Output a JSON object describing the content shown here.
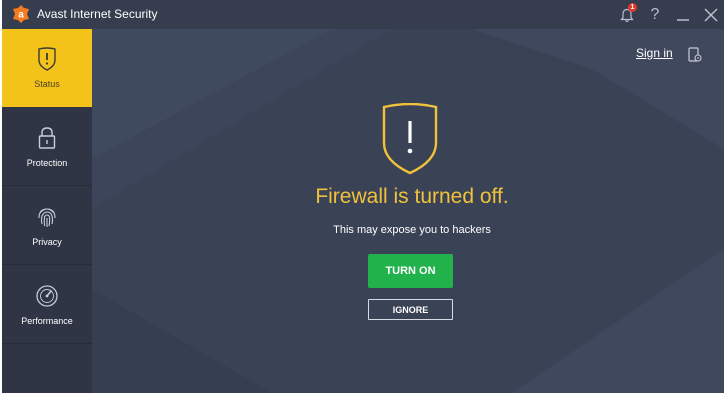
{
  "app": {
    "title": "Avast Internet Security",
    "logo_icon": "avast-logo-icon",
    "accent_color": "#f3c31a",
    "brand_orange": "#f57b20"
  },
  "titlebar": {
    "notifications": {
      "icon": "bell-icon",
      "badge_count": "1"
    },
    "help": {
      "label": "?",
      "icon": "help-icon"
    },
    "minimize_icon": "minimize-icon",
    "close_icon": "close-icon"
  },
  "sidebar": {
    "items": [
      {
        "label": "Status",
        "icon": "status-shield-icon",
        "active": true
      },
      {
        "label": "Protection",
        "icon": "lock-icon",
        "active": false
      },
      {
        "label": "Privacy",
        "icon": "fingerprint-icon",
        "active": false
      },
      {
        "label": "Performance",
        "icon": "speedometer-icon",
        "active": false
      }
    ]
  },
  "header": {
    "sign_in_label": "Sign in",
    "device_icon": "device-settings-icon"
  },
  "alert": {
    "icon": "warning-shield-icon",
    "headline": "Firewall is turned off.",
    "subtext": "This may expose you to hackers",
    "primary_button": "TURN ON",
    "secondary_button": "IGNORE",
    "headline_color": "#f0c23b",
    "primary_color": "#22b24c"
  }
}
